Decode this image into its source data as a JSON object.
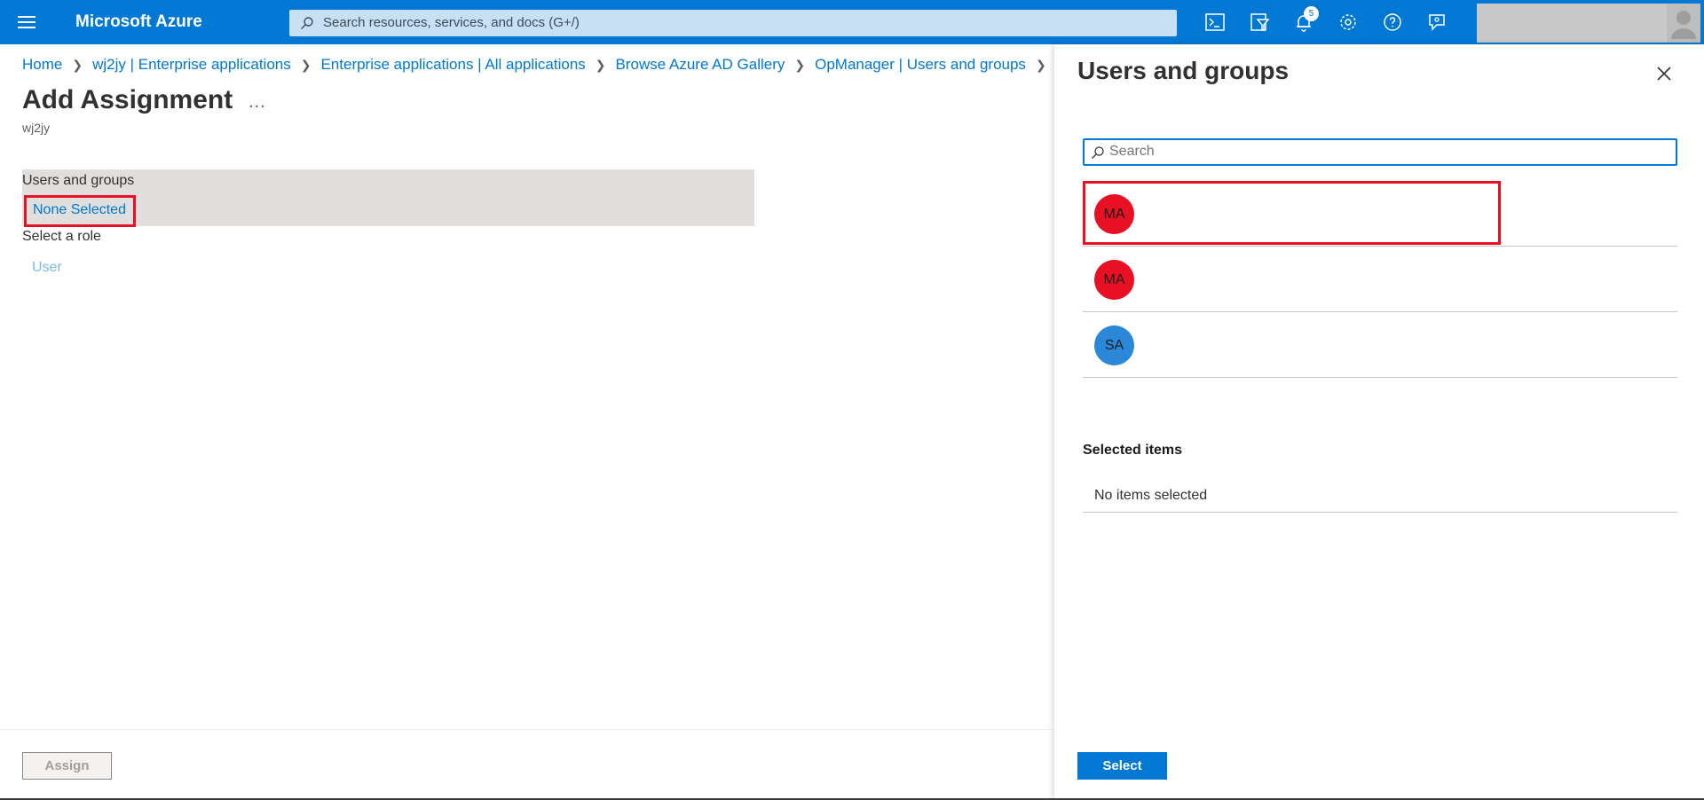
{
  "topbar": {
    "brand": "Microsoft Azure",
    "search_placeholder": "Search resources, services, and docs (G+/)",
    "notification_count": "5",
    "accent": "#0078d4"
  },
  "breadcrumb": {
    "items": [
      "Home",
      "wj2jy | Enterprise applications",
      "Enterprise applications | All applications",
      "Browse Azure AD Gallery",
      "OpManager | Users and groups"
    ]
  },
  "page": {
    "title": "Add Assignment",
    "more": "...",
    "subtitle": "wj2jy",
    "users_groups_label": "Users and groups",
    "none_selected": "None Selected",
    "role_label": "Select a role",
    "role_value": "User",
    "assign_label": "Assign"
  },
  "panel": {
    "title": "Users and groups",
    "search_placeholder": "Search",
    "users": [
      {
        "initials": "MA",
        "color": "#e81123"
      },
      {
        "initials": "MA",
        "color": "#e81123"
      },
      {
        "initials": "SA",
        "color": "#2b88d8"
      }
    ],
    "selected_heading": "Selected items",
    "no_items": "No items selected",
    "select_label": "Select"
  }
}
